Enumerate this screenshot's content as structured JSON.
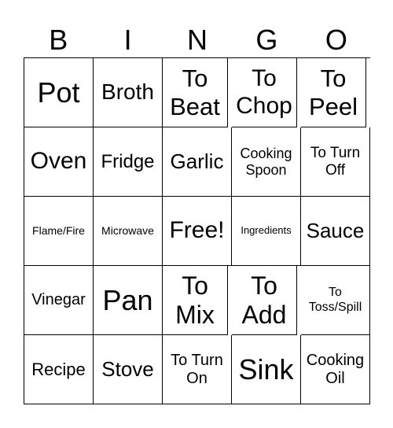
{
  "header": [
    "B",
    "I",
    "N",
    "G",
    "O"
  ],
  "cells": [
    "Pot",
    "Broth",
    "To Beat",
    "To Chop",
    "To Peel",
    "Oven",
    "Fridge",
    "Garlic",
    "Cooking Spoon",
    "To Turn Off",
    "Flame/Fire",
    "Microwave",
    "Free!",
    "Ingredients",
    "Sauce",
    "Vinegar",
    "Pan",
    "To Mix",
    "To Add",
    "To Toss/Spill",
    "Recipe",
    "Stove",
    "To Turn On",
    "Sink",
    "Cooking Oil"
  ]
}
